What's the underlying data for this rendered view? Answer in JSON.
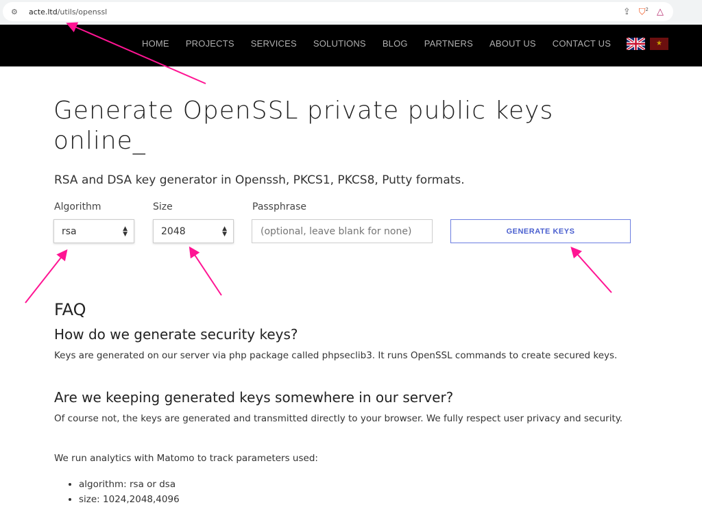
{
  "browser": {
    "url_host": "acte.ltd",
    "url_path": "/utils/openssl",
    "ext_badge": "2"
  },
  "nav": {
    "items": [
      "HOME",
      "PROJECTS",
      "SERVICES",
      "SOLUTIONS",
      "BLOG",
      "PARTNERS",
      "ABOUT US",
      "CONTACT US"
    ],
    "languages": [
      "English",
      "Vietnamese"
    ]
  },
  "page": {
    "title": "Generate OpenSSL private public keys online_",
    "subtitle": "RSA and DSA key generator in Openssh, PKCS1, PKCS8, Putty formats."
  },
  "form": {
    "algorithm_label": "Algorithm",
    "algorithm_value": "rsa",
    "size_label": "Size",
    "size_value": "2048",
    "passphrase_label": "Passphrase",
    "passphrase_placeholder": "(optional, leave blank for none)",
    "generate_label": "GENERATE KEYS"
  },
  "faq": {
    "heading": "FAQ",
    "q1": "How do we generate security keys?",
    "a1": "Keys are generated on our server via php package called phpseclib3. It runs OpenSSL commands to create secured keys.",
    "q2": "Are we keeping generated keys somewhere in our server?",
    "a2": "Of course not, the keys are generated and transmitted directly to your browser. We fully respect user privacy and security.",
    "a3": "We run analytics with Matomo to track parameters used:",
    "list": [
      "algorithm: rsa or dsa",
      "size: 1024,2048,4096"
    ]
  },
  "colors": {
    "annotation_arrow": "#ff1493",
    "button_accent": "#4a5fcf"
  }
}
